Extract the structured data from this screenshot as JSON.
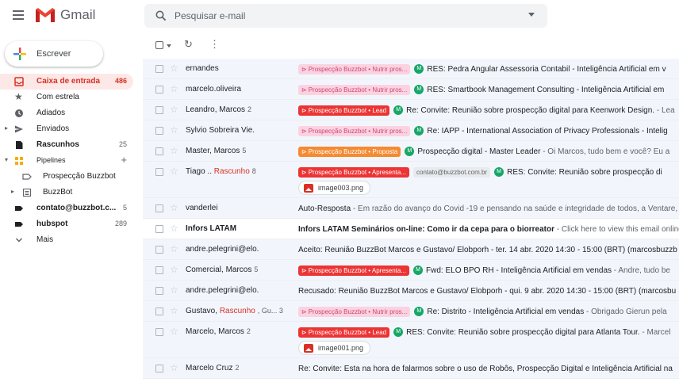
{
  "app": {
    "name": "Gmail"
  },
  "colors": {
    "accent_red": "#d93025",
    "unread_bg": "#ffffff",
    "read_bg": "#f2f6fc",
    "avatar_green": "#16a766"
  },
  "search": {
    "placeholder": "Pesquisar e-mail"
  },
  "compose": {
    "label": "Escrever"
  },
  "sidebar": {
    "items": [
      {
        "label": "Caixa de entrada",
        "count": "486",
        "icon": "inbox-icon"
      },
      {
        "label": "Com estrela",
        "count": "",
        "icon": "star-icon"
      },
      {
        "label": "Adiados",
        "count": "",
        "icon": "clock-icon"
      },
      {
        "label": "Enviados",
        "count": "",
        "icon": "send-icon"
      },
      {
        "label": "Rascunhos",
        "count": "25",
        "icon": "draft-icon"
      },
      {
        "label": "Pipelines",
        "count": "+",
        "icon": "pipelines-icon"
      },
      {
        "label": "Prospecção Buzzbot",
        "count": "",
        "icon": "label-icon"
      },
      {
        "label": "BuzzBot",
        "count": "",
        "icon": "folder-icon"
      },
      {
        "label": "contato@buzzbot.c...",
        "count": "5",
        "icon": "label-icon"
      },
      {
        "label": "hubspot",
        "count": "289",
        "icon": "label-icon"
      },
      {
        "label": "Mais",
        "count": "",
        "icon": "chevron-down-icon"
      }
    ]
  },
  "mails": [
    {
      "sender": "ernandes",
      "draft": "",
      "num": "",
      "tags": [
        {
          "text": "Prospecção Buzzbot • Nutrir pros...",
          "style": "pink"
        }
      ],
      "avatar": "M",
      "subject": "RES: Pedra Angular Assessoria Contabil - Inteligência Artificial em v",
      "snippet": "",
      "unread": false
    },
    {
      "sender": "marcelo.oliveira",
      "draft": "",
      "num": "",
      "tags": [
        {
          "text": "Prospecção Buzzbot • Nutrir pros...",
          "style": "pink"
        }
      ],
      "avatar": "M",
      "subject": "RES: Smartbook Management Consulting - Inteligência Artificial em",
      "snippet": "",
      "unread": false
    },
    {
      "sender": "Leandro, Marcos",
      "draft": "",
      "num": "2",
      "tags": [
        {
          "text": "Prospecção Buzzbot • Lead",
          "style": "red"
        }
      ],
      "avatar": "M",
      "subject": "Re: Convite: Reunião sobre prospecção digital para Keenwork Design.",
      "snippet": " - Lea",
      "unread": false
    },
    {
      "sender": "Sylvio Sobreira Vie.",
      "draft": "",
      "num": "",
      "tags": [
        {
          "text": "Prospecção Buzzbot • Nutrir pros...",
          "style": "pink"
        }
      ],
      "avatar": "M",
      "subject": "Re: IAPP - International Association of Privacy Professionals - Intelig",
      "snippet": "",
      "unread": false
    },
    {
      "sender": "Master, Marcos",
      "draft": "",
      "num": "5",
      "tags": [
        {
          "text": "Prospecção Buzzbot • Proposta",
          "style": "orange"
        }
      ],
      "avatar": "M",
      "subject": "Prospecção digital - Master Leader",
      "snippet": " - Oi Marcos, tudo bem e você? Eu a",
      "unread": false
    },
    {
      "sender": "Tiago .. ",
      "draft": "Rascunho",
      "num": "8",
      "tags": [
        {
          "text": "Prospecção Buzzbot • Apresenta...",
          "style": "red"
        },
        {
          "text": "contato@buzzbot.com.br",
          "style": "grey"
        }
      ],
      "avatar": "M",
      "subject": "RES: Convite: Reunião sobre prospecção di",
      "snippet": "",
      "unread": false,
      "attachment": "image003.png"
    },
    {
      "sender": "vanderlei",
      "draft": "",
      "num": "",
      "tags": [],
      "avatar": "",
      "subject": "Auto-Resposta",
      "snippet": " - Em razão do avanço do Covid -19 e pensando na saúde e integridade de todos, a Ventare,",
      "unread": false
    },
    {
      "sender": "Infors LATAM",
      "draft": "",
      "num": "",
      "tags": [],
      "avatar": "",
      "subject": "Infors LATAM Seminários on-line: Como ir da cepa para o biorreator",
      "snippet": " - Click here to view this email online.",
      "unread": true
    },
    {
      "sender": "andre.pelegrini@elo.",
      "draft": "",
      "num": "",
      "tags": [],
      "avatar": "",
      "subject": "Aceito: Reunião BuzzBot Marcos e Gustavo/ Elobporh - ter. 14 abr. 2020 14:30 - 15:00 (BRT) (marcosbuzzb",
      "snippet": "",
      "unread": false
    },
    {
      "sender": "Comercial, Marcos",
      "draft": "",
      "num": "5",
      "tags": [
        {
          "text": "Prospecção Buzzbot • Apresenta...",
          "style": "red"
        }
      ],
      "avatar": "M",
      "subject": "Fwd: ELO BPO RH - Inteligência Artificial em vendas",
      "snippet": " - Andre, tudo be",
      "unread": false
    },
    {
      "sender": "andre.pelegrini@elo.",
      "draft": "",
      "num": "",
      "tags": [],
      "avatar": "",
      "subject": "Recusado: Reunião BuzzBot Marcos e Gustavo/ Elobporh - qui. 9 abr. 2020 14:30 - 15:00 (BRT) (marcosbu",
      "snippet": "",
      "unread": false
    },
    {
      "sender": "Gustavo, ",
      "draft": "Rascunho",
      "num": ", Gu... 3",
      "tags": [
        {
          "text": "Prospecção Buzzbot • Nutrir pros...",
          "style": "pink"
        }
      ],
      "avatar": "M",
      "subject": "Re: Distrito - Inteligência Artificial em vendas",
      "snippet": " - Obrigado Gierun pela",
      "unread": false
    },
    {
      "sender": "Marcelo, Marcos",
      "draft": "",
      "num": "2",
      "tags": [
        {
          "text": "Prospecção Buzzbot • Lead",
          "style": "red"
        }
      ],
      "avatar": "M",
      "subject": "RES: Convite: Reunião sobre prospecção digital para Atlanta Tour.",
      "snippet": " - Marcel",
      "unread": false,
      "attachment": "image001.png"
    },
    {
      "sender": "Marcelo Cruz",
      "draft": "",
      "num": "2",
      "tags": [],
      "avatar": "",
      "subject": "Re: Convite: Esta na hora de falarmos sobre o uso de Robôs, Prospecção Digital e Inteligência Artificial na",
      "snippet": "",
      "unread": false
    }
  ]
}
